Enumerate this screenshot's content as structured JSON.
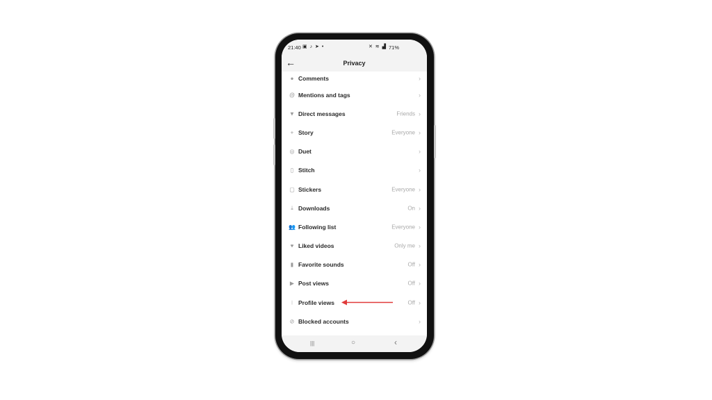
{
  "status_bar": {
    "time": "21:40",
    "left_icons": [
      "gallery-icon",
      "tiktok-icon",
      "telegram-icon",
      "dot-icon"
    ],
    "right_icons": [
      "mute-icon",
      "wifi-icon",
      "signal-icon"
    ],
    "battery": "71%"
  },
  "header": {
    "back_icon": "arrow-left-icon",
    "title": "Privacy"
  },
  "settings": [
    {
      "icon": "comment-icon",
      "glyph": "●",
      "label": "Comments",
      "value": ""
    },
    {
      "icon": "at-icon",
      "glyph": "@",
      "label": "Mentions and tags",
      "value": ""
    },
    {
      "icon": "send-icon",
      "glyph": "▼",
      "label": "Direct messages",
      "value": "Friends"
    },
    {
      "icon": "sparkle-icon",
      "glyph": "+",
      "label": "Story",
      "value": "Everyone"
    },
    {
      "icon": "duet-icon",
      "glyph": "◎",
      "label": "Duet",
      "value": ""
    },
    {
      "icon": "stitch-icon",
      "glyph": "▯",
      "label": "Stitch",
      "value": ""
    },
    {
      "icon": "sticker-icon",
      "glyph": "▢",
      "label": "Stickers",
      "value": "Everyone"
    },
    {
      "icon": "download-icon",
      "glyph": "⤓",
      "label": "Downloads",
      "value": "On"
    },
    {
      "icon": "users-icon",
      "glyph": "👥",
      "label": "Following list",
      "value": "Everyone"
    },
    {
      "icon": "heart-icon",
      "glyph": "♥",
      "label": "Liked videos",
      "value": "Only me"
    },
    {
      "icon": "bookmark-icon",
      "glyph": "▮",
      "label": "Favorite sounds",
      "value": "Off"
    },
    {
      "icon": "play-icon",
      "glyph": "▶",
      "label": "Post views",
      "value": "Off"
    },
    {
      "icon": "footprints-icon",
      "glyph": "⁝",
      "label": "Profile views",
      "value": "Off"
    },
    {
      "icon": "block-icon",
      "glyph": "⊘",
      "label": "Blocked accounts",
      "value": ""
    }
  ],
  "annotation": {
    "arrow_color": "#e03a3a",
    "points_to": "Profile views"
  },
  "nav_bar": {
    "recents": "|||",
    "home": "○",
    "back": "‹"
  }
}
